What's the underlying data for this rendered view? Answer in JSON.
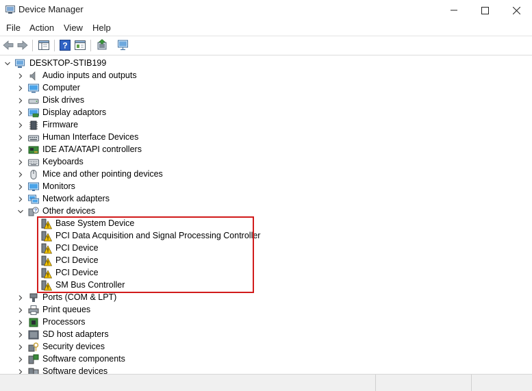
{
  "window": {
    "title": "Device Manager",
    "icon": "device-manager-icon",
    "controls": [
      "minimize",
      "maximize",
      "close"
    ]
  },
  "menu": {
    "file": "File",
    "action": "Action",
    "view": "View",
    "help": "Help"
  },
  "toolbar": {
    "icons": [
      "back-arrow-icon",
      "forward-arrow-icon",
      "show-hide-console-tree-icon",
      "help-icon",
      "properties-icon",
      "update-driver-icon",
      "scan-hardware-changes-icon"
    ]
  },
  "tree": {
    "root": "DESKTOP-STIB199",
    "categories": {
      "audio": "Audio inputs and outputs",
      "computer": "Computer",
      "disk": "Disk drives",
      "display": "Display adaptors",
      "firmware": "Firmware",
      "hid": "Human Interface Devices",
      "ide": "IDE ATA/ATAPI controllers",
      "keyboards": "Keyboards",
      "mice": "Mice and other pointing devices",
      "monitors": "Monitors",
      "network": "Network adapters",
      "other": "Other devices",
      "ports": "Ports (COM & LPT)",
      "print": "Print queues",
      "processors": "Processors",
      "sdhost": "SD host adapters",
      "security": "Security devices",
      "swcomponents": "Software components",
      "swdevices": "Software devices"
    },
    "other_devices": [
      "Base System Device",
      "PCI Data Acquisition and Signal Processing Controller",
      "PCI Device",
      "PCI Device",
      "PCI Device",
      "SM Bus Controller"
    ]
  },
  "colors": {
    "highlight": "#d11a1a",
    "warning": "#f2c200"
  }
}
